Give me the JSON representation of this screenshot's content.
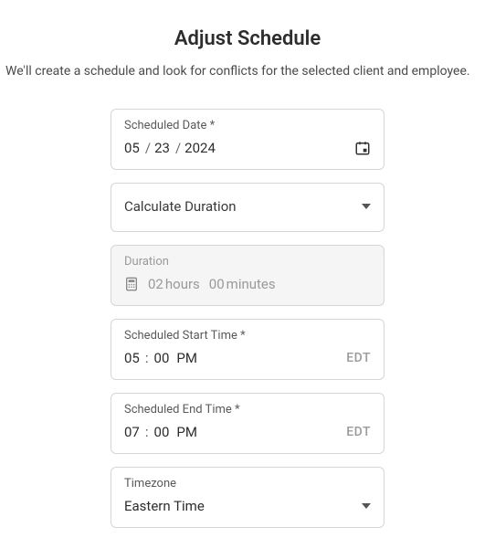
{
  "title": "Adjust Schedule",
  "subtitle": "We'll create a schedule and look for conflicts for the selected client and employee.",
  "scheduledDate": {
    "label": "Scheduled Date *",
    "mm": "05",
    "dd": "23",
    "yyyy": "2024"
  },
  "calcDuration": {
    "label": "Calculate Duration"
  },
  "duration": {
    "label": "Duration",
    "hours": "02",
    "hoursWord": "hours",
    "minutes": "00",
    "minutesWord": "minutes"
  },
  "startTime": {
    "label": "Scheduled Start Time *",
    "hh": "05",
    "mm": "00",
    "ampm": "PM",
    "tz": "EDT"
  },
  "endTime": {
    "label": "Scheduled End Time *",
    "hh": "07",
    "mm": "00",
    "ampm": "PM",
    "tz": "EDT"
  },
  "timezone": {
    "label": "Timezone",
    "value": "Eastern Time"
  }
}
